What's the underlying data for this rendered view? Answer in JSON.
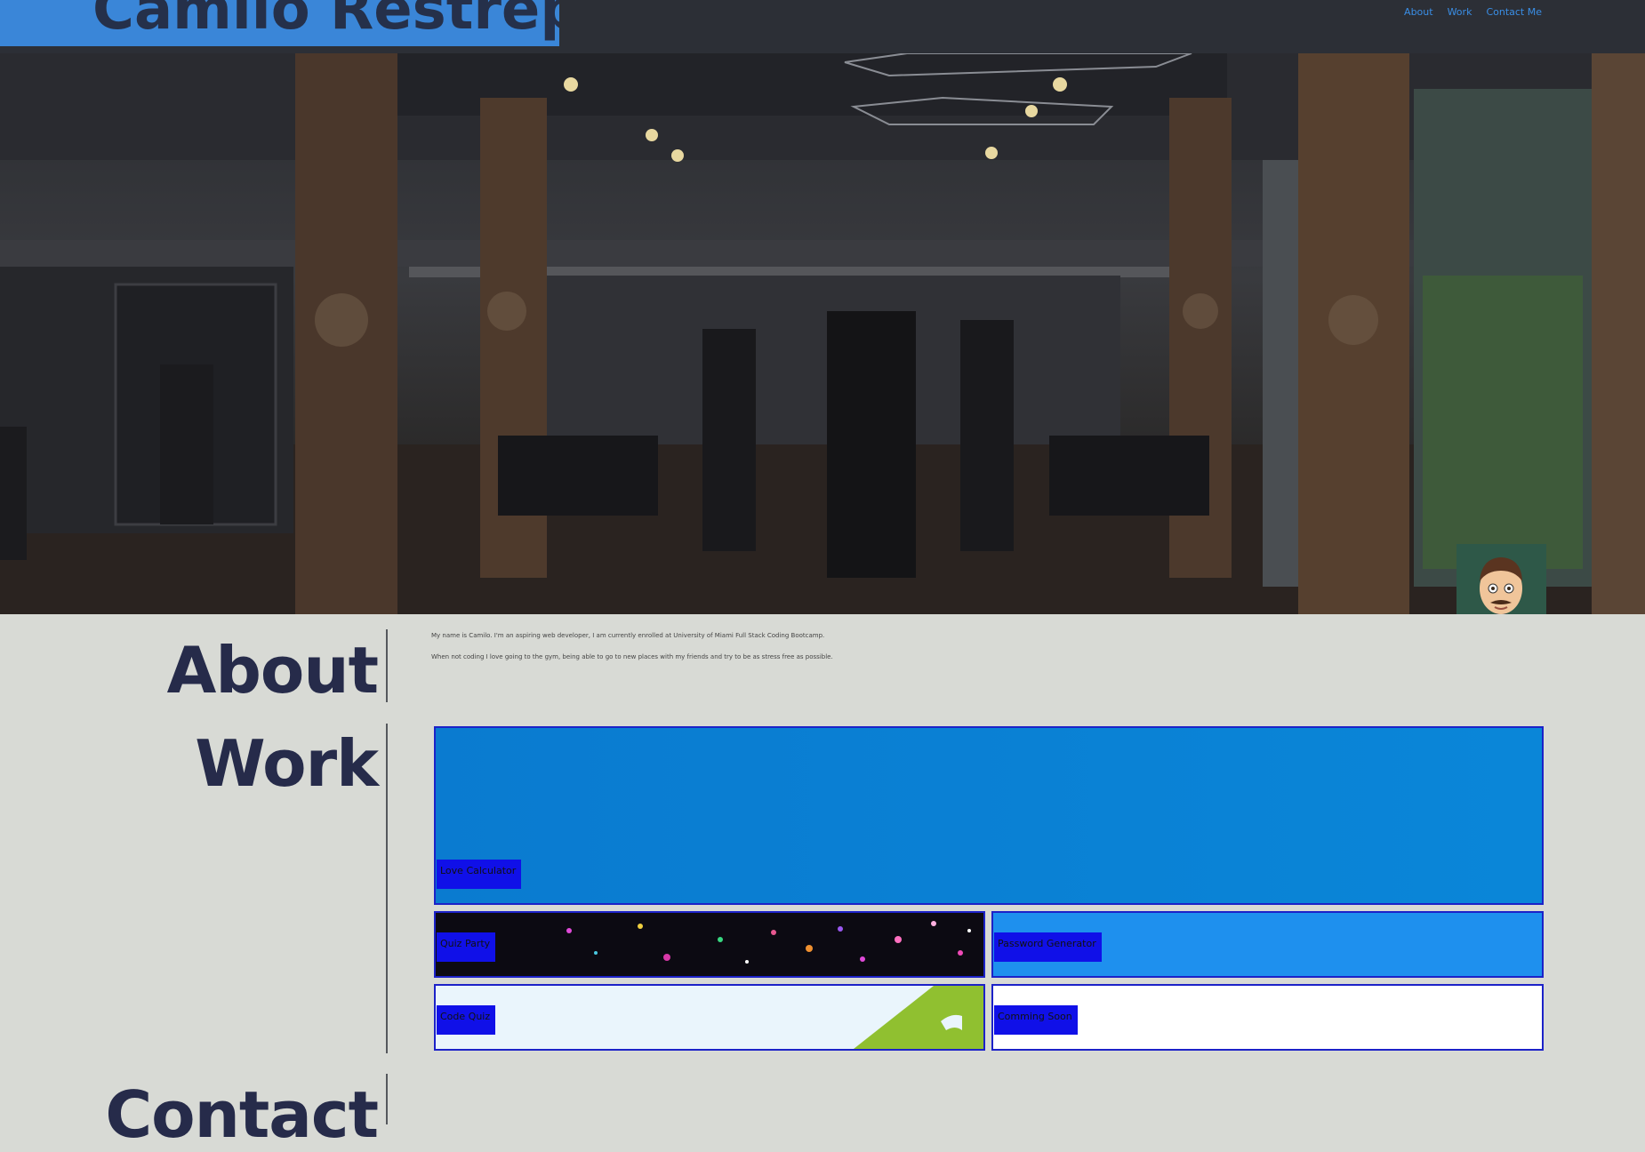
{
  "header": {
    "brand": "Camilo Restrepo",
    "nav": [
      "About",
      "Work",
      "Contact Me"
    ]
  },
  "hero": {
    "image": "gym-interior",
    "avatar": "cartoon-avatar"
  },
  "about": {
    "title": "About",
    "paragraphs": [
      "My name is Camilo. I'm an aspiring web developer, I am currently enrolled at University of Miami Full Stack Coding Bootcamp.",
      "When not coding I love going to the gym, being able to go to new places with my friends and try to be as stress free as possible."
    ]
  },
  "work": {
    "title": "Work",
    "projects": [
      {
        "label": "Love Calculator"
      },
      {
        "label": "Quiz Party"
      },
      {
        "label": "Password Generator"
      },
      {
        "label": "Code Quiz"
      },
      {
        "label": "Comming Soon"
      }
    ]
  },
  "contact": {
    "title": "Contact"
  },
  "colors": {
    "accent": "#3a86d8",
    "header_bg": "#2c2f36",
    "page_bg": "#d8dad5",
    "heading": "#262b4a",
    "card_border": "#1c22c8",
    "label_bg": "#1010e8"
  }
}
